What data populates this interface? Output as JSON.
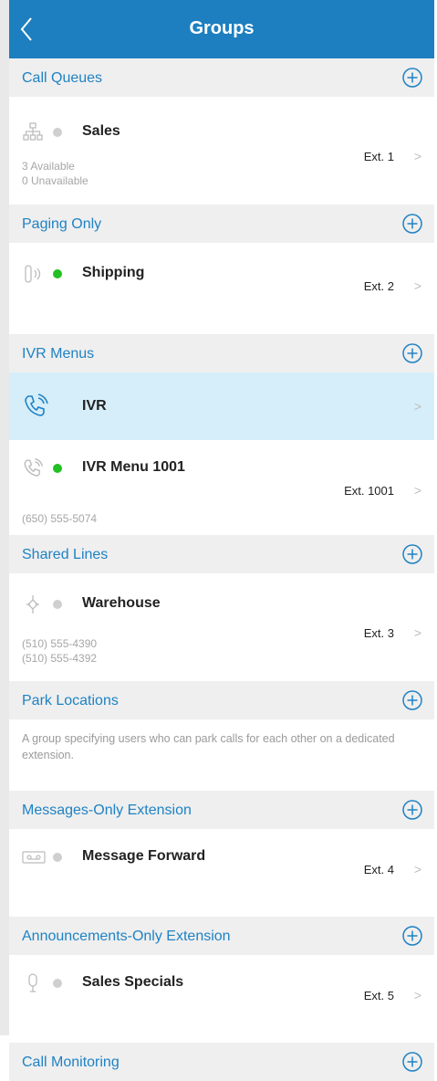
{
  "header": {
    "title": "Groups"
  },
  "colors": {
    "accent": "#1f82c4",
    "header_bg": "#1d7fbf",
    "available": "#22c022",
    "unavailable": "#cfcfcf",
    "selected_bg": "#d6eef9"
  },
  "sections": {
    "call_queues": {
      "label": "Call Queues",
      "rows": [
        {
          "name": "Sales",
          "ext": "Ext. 1",
          "sub1": "3 Available",
          "sub2": "0 Unavailable",
          "icon": "queue-icon"
        }
      ]
    },
    "paging_only": {
      "label": "Paging Only",
      "rows": [
        {
          "name": "Shipping",
          "ext": "Ext. 2",
          "icon": "paging-icon"
        }
      ]
    },
    "ivr_menus": {
      "label": "IVR Menus",
      "rows": [
        {
          "name": "IVR",
          "icon": "phone-ringing-icon"
        },
        {
          "name": "IVR Menu 1001",
          "ext": "Ext. 1001",
          "sub1": "(650) 555-5074",
          "icon": "phone-ringing-icon"
        }
      ]
    },
    "shared_lines": {
      "label": "Shared Lines",
      "rows": [
        {
          "name": "Warehouse",
          "ext": "Ext. 3",
          "sub1": "(510) 555-4390",
          "sub2": "(510) 555-4392",
          "icon": "shared-line-icon"
        }
      ]
    },
    "park_locations": {
      "label": "Park Locations",
      "description": "A group specifying users who can park calls for each other on a dedicated extension."
    },
    "messages_only": {
      "label": "Messages-Only Extension",
      "rows": [
        {
          "name": "Message Forward",
          "ext": "Ext. 4",
          "icon": "voicemail-icon"
        }
      ]
    },
    "announcements_only": {
      "label": "Announcements-Only Extension",
      "rows": [
        {
          "name": "Sales Specials",
          "ext": "Ext. 5",
          "icon": "microphone-icon"
        }
      ]
    },
    "call_monitoring": {
      "label": "Call Monitoring"
    }
  }
}
